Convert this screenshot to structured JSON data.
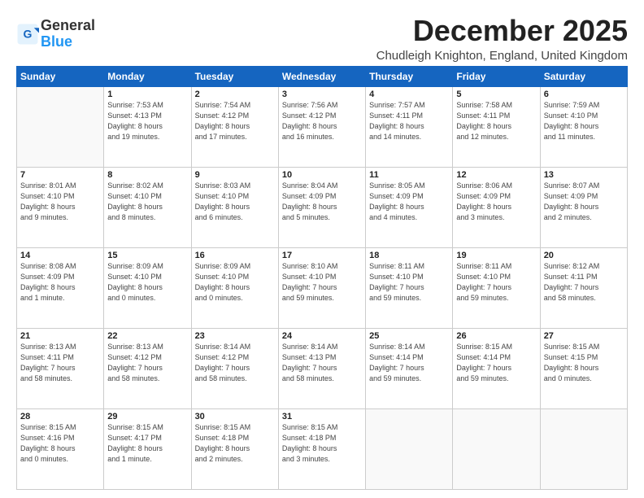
{
  "header": {
    "logo_general": "General",
    "logo_blue": "Blue",
    "month": "December 2025",
    "location": "Chudleigh Knighton, England, United Kingdom"
  },
  "weekdays": [
    "Sunday",
    "Monday",
    "Tuesday",
    "Wednesday",
    "Thursday",
    "Friday",
    "Saturday"
  ],
  "weeks": [
    [
      {
        "day": "",
        "info": ""
      },
      {
        "day": "1",
        "info": "Sunrise: 7:53 AM\nSunset: 4:13 PM\nDaylight: 8 hours\nand 19 minutes."
      },
      {
        "day": "2",
        "info": "Sunrise: 7:54 AM\nSunset: 4:12 PM\nDaylight: 8 hours\nand 17 minutes."
      },
      {
        "day": "3",
        "info": "Sunrise: 7:56 AM\nSunset: 4:12 PM\nDaylight: 8 hours\nand 16 minutes."
      },
      {
        "day": "4",
        "info": "Sunrise: 7:57 AM\nSunset: 4:11 PM\nDaylight: 8 hours\nand 14 minutes."
      },
      {
        "day": "5",
        "info": "Sunrise: 7:58 AM\nSunset: 4:11 PM\nDaylight: 8 hours\nand 12 minutes."
      },
      {
        "day": "6",
        "info": "Sunrise: 7:59 AM\nSunset: 4:10 PM\nDaylight: 8 hours\nand 11 minutes."
      }
    ],
    [
      {
        "day": "7",
        "info": "Sunrise: 8:01 AM\nSunset: 4:10 PM\nDaylight: 8 hours\nand 9 minutes."
      },
      {
        "day": "8",
        "info": "Sunrise: 8:02 AM\nSunset: 4:10 PM\nDaylight: 8 hours\nand 8 minutes."
      },
      {
        "day": "9",
        "info": "Sunrise: 8:03 AM\nSunset: 4:10 PM\nDaylight: 8 hours\nand 6 minutes."
      },
      {
        "day": "10",
        "info": "Sunrise: 8:04 AM\nSunset: 4:09 PM\nDaylight: 8 hours\nand 5 minutes."
      },
      {
        "day": "11",
        "info": "Sunrise: 8:05 AM\nSunset: 4:09 PM\nDaylight: 8 hours\nand 4 minutes."
      },
      {
        "day": "12",
        "info": "Sunrise: 8:06 AM\nSunset: 4:09 PM\nDaylight: 8 hours\nand 3 minutes."
      },
      {
        "day": "13",
        "info": "Sunrise: 8:07 AM\nSunset: 4:09 PM\nDaylight: 8 hours\nand 2 minutes."
      }
    ],
    [
      {
        "day": "14",
        "info": "Sunrise: 8:08 AM\nSunset: 4:09 PM\nDaylight: 8 hours\nand 1 minute."
      },
      {
        "day": "15",
        "info": "Sunrise: 8:09 AM\nSunset: 4:10 PM\nDaylight: 8 hours\nand 0 minutes."
      },
      {
        "day": "16",
        "info": "Sunrise: 8:09 AM\nSunset: 4:10 PM\nDaylight: 8 hours\nand 0 minutes."
      },
      {
        "day": "17",
        "info": "Sunrise: 8:10 AM\nSunset: 4:10 PM\nDaylight: 7 hours\nand 59 minutes."
      },
      {
        "day": "18",
        "info": "Sunrise: 8:11 AM\nSunset: 4:10 PM\nDaylight: 7 hours\nand 59 minutes."
      },
      {
        "day": "19",
        "info": "Sunrise: 8:11 AM\nSunset: 4:10 PM\nDaylight: 7 hours\nand 59 minutes."
      },
      {
        "day": "20",
        "info": "Sunrise: 8:12 AM\nSunset: 4:11 PM\nDaylight: 7 hours\nand 58 minutes."
      }
    ],
    [
      {
        "day": "21",
        "info": "Sunrise: 8:13 AM\nSunset: 4:11 PM\nDaylight: 7 hours\nand 58 minutes."
      },
      {
        "day": "22",
        "info": "Sunrise: 8:13 AM\nSunset: 4:12 PM\nDaylight: 7 hours\nand 58 minutes."
      },
      {
        "day": "23",
        "info": "Sunrise: 8:14 AM\nSunset: 4:12 PM\nDaylight: 7 hours\nand 58 minutes."
      },
      {
        "day": "24",
        "info": "Sunrise: 8:14 AM\nSunset: 4:13 PM\nDaylight: 7 hours\nand 58 minutes."
      },
      {
        "day": "25",
        "info": "Sunrise: 8:14 AM\nSunset: 4:14 PM\nDaylight: 7 hours\nand 59 minutes."
      },
      {
        "day": "26",
        "info": "Sunrise: 8:15 AM\nSunset: 4:14 PM\nDaylight: 7 hours\nand 59 minutes."
      },
      {
        "day": "27",
        "info": "Sunrise: 8:15 AM\nSunset: 4:15 PM\nDaylight: 8 hours\nand 0 minutes."
      }
    ],
    [
      {
        "day": "28",
        "info": "Sunrise: 8:15 AM\nSunset: 4:16 PM\nDaylight: 8 hours\nand 0 minutes."
      },
      {
        "day": "29",
        "info": "Sunrise: 8:15 AM\nSunset: 4:17 PM\nDaylight: 8 hours\nand 1 minute."
      },
      {
        "day": "30",
        "info": "Sunrise: 8:15 AM\nSunset: 4:18 PM\nDaylight: 8 hours\nand 2 minutes."
      },
      {
        "day": "31",
        "info": "Sunrise: 8:15 AM\nSunset: 4:18 PM\nDaylight: 8 hours\nand 3 minutes."
      },
      {
        "day": "",
        "info": ""
      },
      {
        "day": "",
        "info": ""
      },
      {
        "day": "",
        "info": ""
      }
    ]
  ]
}
